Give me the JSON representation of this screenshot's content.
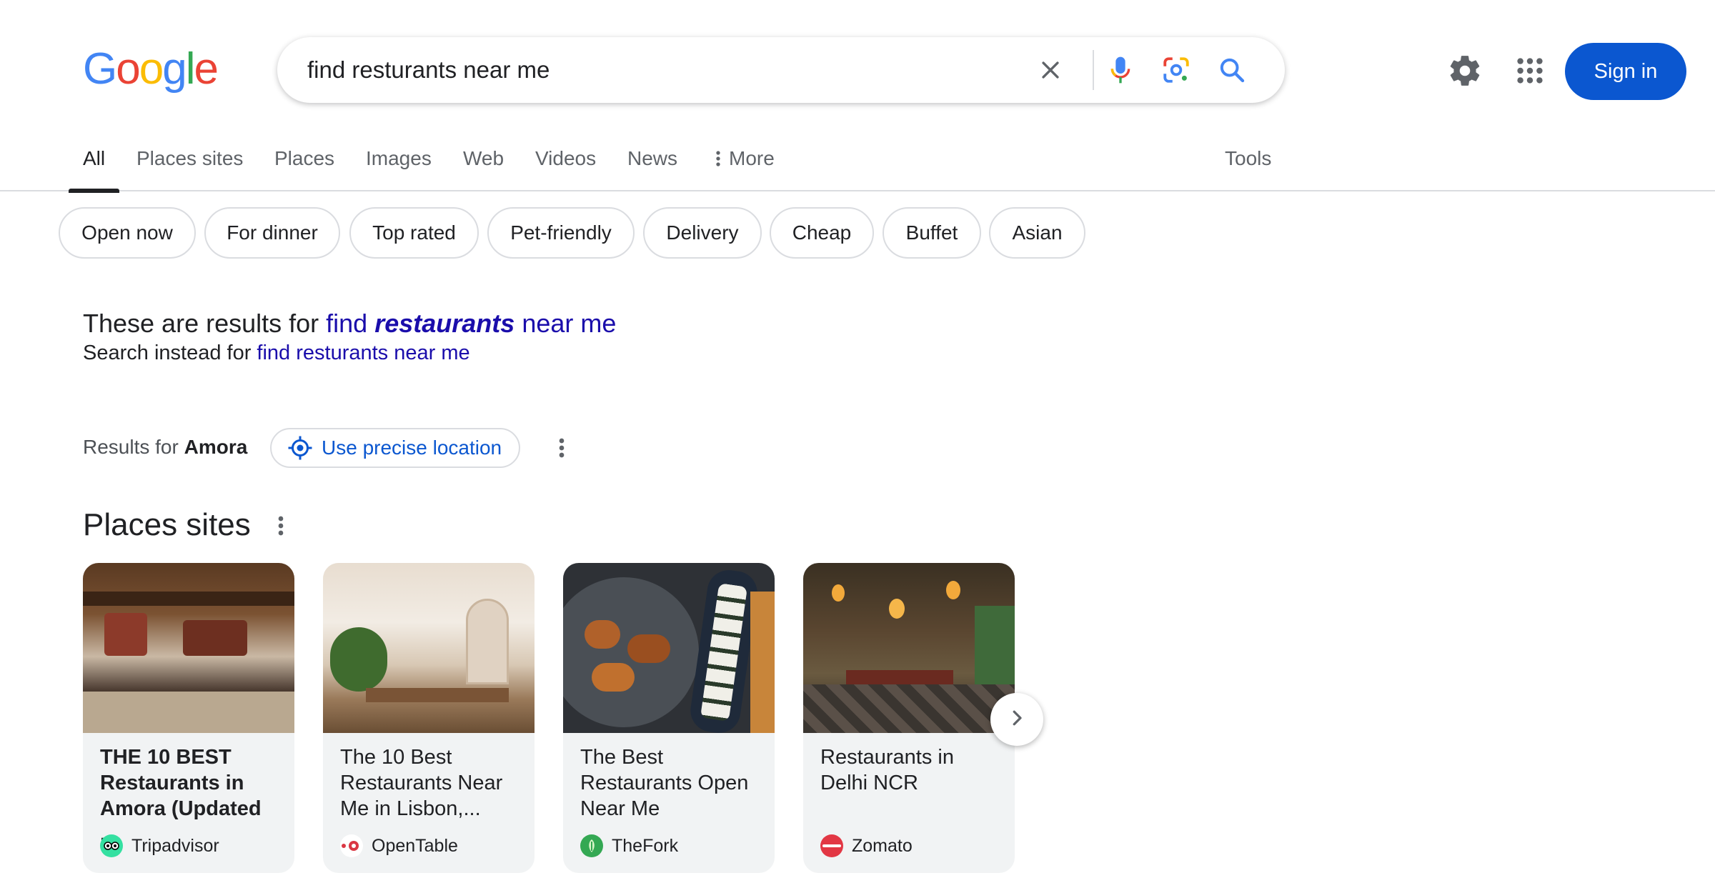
{
  "header": {
    "logo_text": "Google",
    "search_query": "find resturants near me",
    "signin_label": "Sign in"
  },
  "tabs": [
    {
      "label": "All",
      "active": true
    },
    {
      "label": "Places sites"
    },
    {
      "label": "Places"
    },
    {
      "label": "Images"
    },
    {
      "label": "Web"
    },
    {
      "label": "Videos"
    },
    {
      "label": "News"
    },
    {
      "label": "More"
    }
  ],
  "tools_label": "Tools",
  "chips": [
    "Open now",
    "For dinner",
    "Top rated",
    "Pet-friendly",
    "Delivery",
    "Cheap",
    "Buffet",
    "Asian"
  ],
  "spelling": {
    "prefix": "These are results for",
    "corrected_pre": "find",
    "corrected_em": "restaurants",
    "corrected_post": "near me",
    "instead_prefix": "Search instead for",
    "instead_link": "find resturants near me"
  },
  "location": {
    "prefix": "Results for",
    "place": "Amora",
    "precise_label": "Use precise location"
  },
  "places_sites": {
    "title": "Places sites",
    "cards": [
      {
        "title": "THE 10 BEST Restaurants in Amora (Updated ...",
        "source": "Tripadvisor",
        "bold": true
      },
      {
        "title": "The 10 Best Restaurants Near Me in Lisbon,...",
        "source": "OpenTable"
      },
      {
        "title": "The Best Restaurants Open Near Me",
        "source": "TheFork"
      },
      {
        "title": "Restaurants in Delhi NCR",
        "source": "Zomato"
      }
    ]
  },
  "icons": {
    "clear": "close-icon",
    "voice": "microphone-icon",
    "lens": "camera-lens-icon",
    "search": "search-icon",
    "settings": "gear-icon",
    "apps": "apps-grid-icon",
    "next": "chevron-right-icon"
  },
  "colors": {
    "accent": "#0b57d0",
    "link": "#1a0dab",
    "google_blue": "#4285F4",
    "google_red": "#EA4335",
    "google_yellow": "#FBBC05",
    "google_green": "#34A853"
  }
}
